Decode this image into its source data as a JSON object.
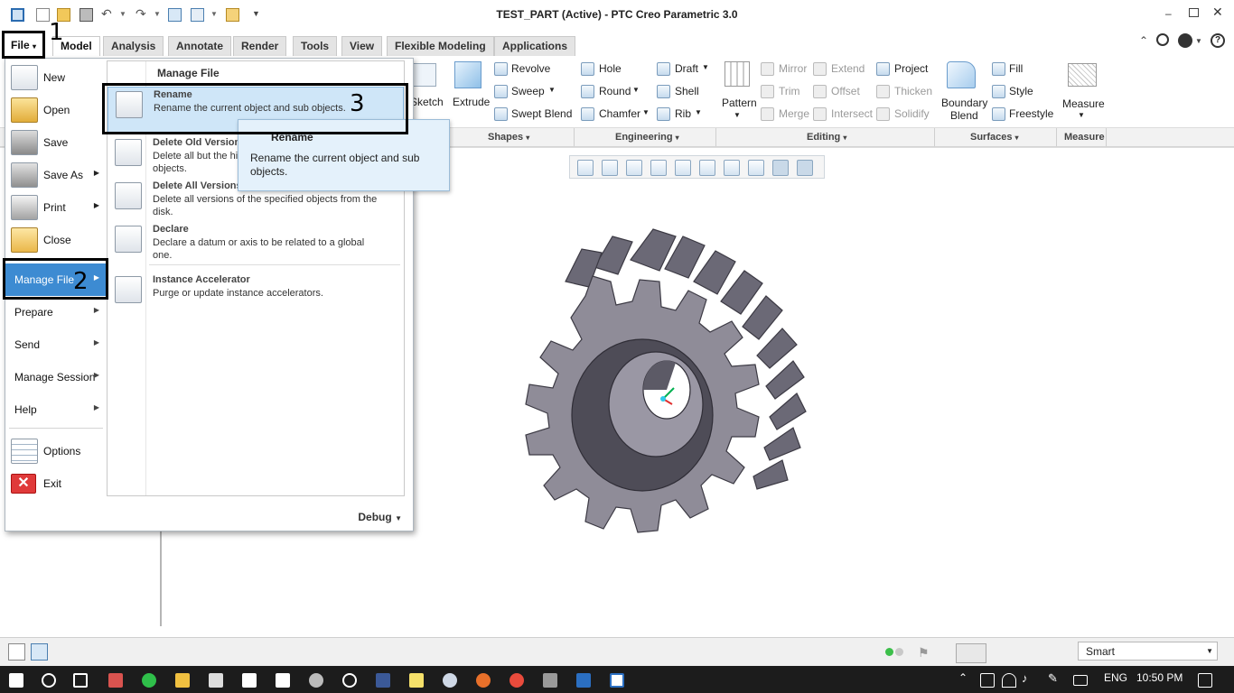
{
  "window": {
    "title": "TEST_PART (Active) - PTC Creo Parametric 3.0"
  },
  "tabs": [
    {
      "label": "File"
    },
    {
      "label": "Model"
    },
    {
      "label": "Analysis"
    },
    {
      "label": "Annotate"
    },
    {
      "label": "Render"
    },
    {
      "label": "Tools"
    },
    {
      "label": "View"
    },
    {
      "label": "Flexible Modeling"
    },
    {
      "label": "Applications"
    }
  ],
  "ribbon": {
    "sketch": "Sketch",
    "extrude": "Extrude",
    "revolve": "Revolve",
    "sweep": "Sweep",
    "swept_blend": "Swept Blend",
    "hole": "Hole",
    "round": "Round",
    "chamfer": "Chamfer",
    "draft": "Draft",
    "shell": "Shell",
    "rib": "Rib",
    "pattern": "Pattern",
    "mirror": "Mirror",
    "trim": "Trim",
    "merge": "Merge",
    "extend": "Extend",
    "offset": "Offset",
    "intersect": "Intersect",
    "project": "Project",
    "thicken": "Thicken",
    "solidify": "Solidify",
    "boundary_blend_1": "Boundary",
    "boundary_blend_2": "Blend",
    "fill": "Fill",
    "style": "Style",
    "freestyle": "Freestyle",
    "measure": "Measure",
    "groups": {
      "shapes": "Shapes",
      "engineering": "Engineering",
      "editing": "Editing",
      "surfaces": "Surfaces",
      "measure": "Measure"
    }
  },
  "file_menu": {
    "items": [
      {
        "label": "New"
      },
      {
        "label": "Open"
      },
      {
        "label": "Save"
      },
      {
        "label": "Save As"
      },
      {
        "label": "Print"
      },
      {
        "label": "Close"
      }
    ],
    "submenus": [
      {
        "label": "Manage File"
      },
      {
        "label": "Prepare"
      },
      {
        "label": "Send"
      },
      {
        "label": "Manage Session"
      },
      {
        "label": "Help"
      }
    ],
    "options": "Options",
    "exit": "Exit",
    "debug": "Debug"
  },
  "manage_file": {
    "title": "Manage File",
    "items": [
      {
        "title": "Rename",
        "desc": "Rename the current object and sub objects."
      },
      {
        "title": "Delete Old Versions",
        "desc": "Delete all but the highest version of the specified objects."
      },
      {
        "title": "Delete All Versions",
        "desc": "Delete all versions of the specified objects from the disk."
      },
      {
        "title": "Declare",
        "desc": "Declare a datum or axis to be related to a global one."
      },
      {
        "title": "Instance Accelerator",
        "desc": "Purge or update instance accelerators."
      }
    ]
  },
  "tooltip": {
    "title": "Rename",
    "desc": "Rename the current object and sub objects."
  },
  "annotations": {
    "n1": "1",
    "n2": "2",
    "n3": "3"
  },
  "statusbar": {
    "filter": "Smart"
  },
  "taskbar": {
    "lang": "ENG",
    "time": "10:50 PM"
  },
  "colors": {
    "accent": "#3b84c4",
    "highlight": "#cfe6f8",
    "gear": "#8f8c98"
  }
}
